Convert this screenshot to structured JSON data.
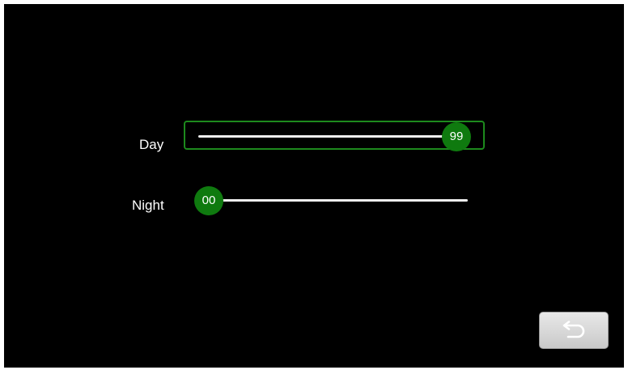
{
  "settings": {
    "day": {
      "label": "Day",
      "value": "99",
      "level": 0.99,
      "focused": true
    },
    "night": {
      "label": "Night",
      "value": "00",
      "level": 0.0,
      "focused": false
    }
  },
  "colors": {
    "background": "#000000",
    "accent": "#0f7a0f",
    "focus_border": "#1d8a1d",
    "track": "#f0f0f0"
  },
  "back_button": {
    "icon": "return-arrow-icon"
  }
}
